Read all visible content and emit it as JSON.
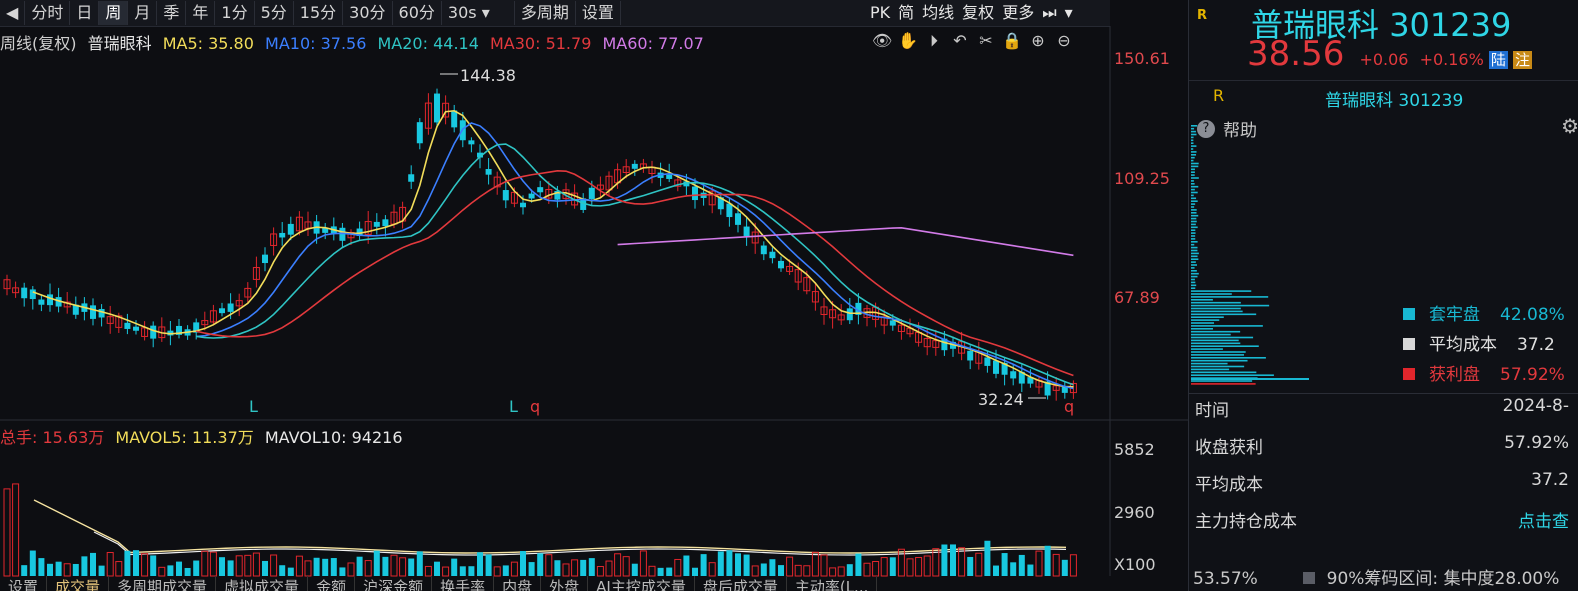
{
  "toolbar": {
    "tabs": [
      "分时",
      "日",
      "周",
      "月",
      "季",
      "年",
      "1分",
      "5分",
      "15分",
      "30分",
      "60分",
      "30s",
      "多周期",
      "设置"
    ],
    "active_tab": "周",
    "right_items": [
      "PK",
      "简",
      "均线",
      "复权",
      "更多"
    ]
  },
  "ma_legend": {
    "title": "周线(复权)",
    "stock": "普瑞眼科",
    "ma5": "MA5: 35.80",
    "ma10": "MA10: 37.56",
    "ma20": "MA20: 44.14",
    "ma30": "MA30: 51.79",
    "ma60": "MA60: 77.07",
    "colors": {
      "ma5": "#f2dd5a",
      "ma10": "#3b7fff",
      "ma20": "#2fc4c4",
      "ma30": "#e2393d",
      "ma60": "#d27be8"
    }
  },
  "price_axis": {
    "labels": [
      "150.61",
      "109.25",
      "67.89"
    ]
  },
  "annotations": {
    "high": "144.38",
    "low": "32.24",
    "markers": [
      "L",
      "L",
      "q",
      "q"
    ]
  },
  "volume": {
    "legend_vol": "总手: 15.63万",
    "mavol5": "MAVOL5: 11.37万",
    "mavol10": "MAVOL10: 94216",
    "axis": [
      "5852",
      "2960",
      "X100"
    ]
  },
  "bottom_tabs": [
    "设置",
    "成交量",
    "多周期成交量",
    "虚拟成交量",
    "金额",
    "沪深金额",
    "换手率",
    "内盘",
    "外盘",
    "AI主控成交量",
    "盘后成交量",
    "主动率(L..."
  ],
  "side": {
    "badge": "R",
    "name": "普瑞眼科",
    "code": "301239",
    "price": "38.56",
    "change": "+0.06",
    "pct": "+0.16%",
    "tag1": "陆",
    "tag2": "注",
    "sub_badge": "R",
    "sub_title": "普瑞眼科 301239",
    "help": "帮助",
    "legend": [
      {
        "label": "套牢盘",
        "value": "42.08%",
        "color": "#18b8d2"
      },
      {
        "label": "平均成本",
        "value": "37.2",
        "color": "#d8d8d8"
      },
      {
        "label": "获利盘",
        "value": "57.92%",
        "color": "#e2262c"
      }
    ],
    "rows": [
      {
        "label": "时间",
        "value": "2024-8-"
      },
      {
        "label": "收盘获利",
        "value": "57.92%"
      },
      {
        "label": "平均成本",
        "value": "37.2"
      },
      {
        "label": "主力持仓成本",
        "value": "点击查"
      }
    ],
    "footer": {
      "pct": "53.57%",
      "range_label": "90%筹码区间:",
      "conc": "集中度28.00%"
    }
  }
}
